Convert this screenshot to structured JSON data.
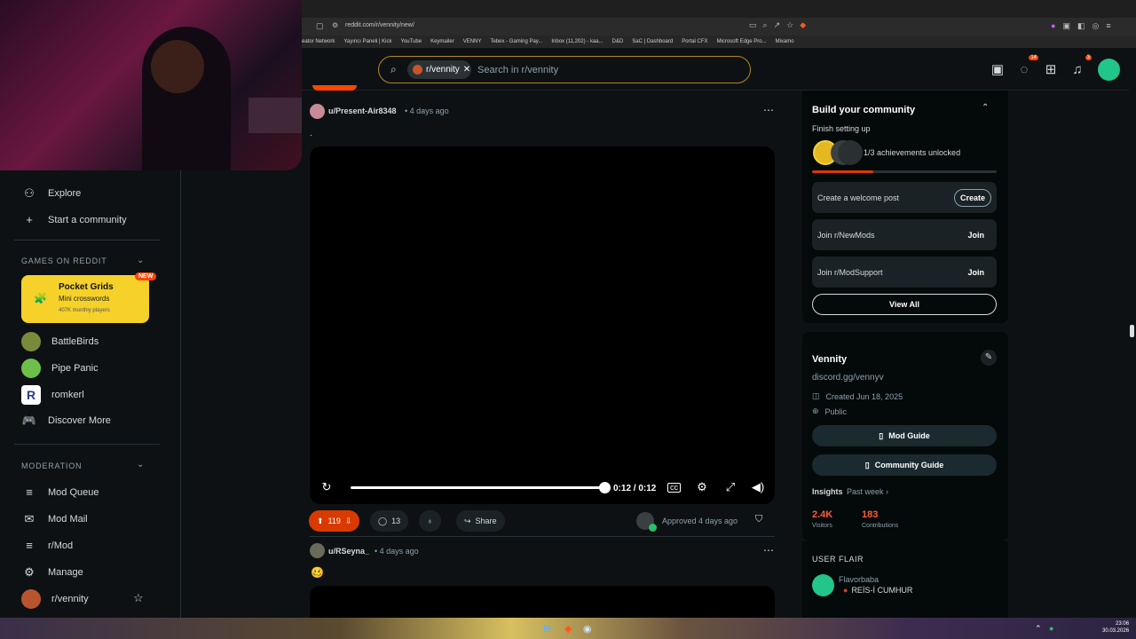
{
  "browser": {
    "url": "reddit.com/r/vennity/new/",
    "bookmarks": [
      "eator Network",
      "Yayıncı Paneli | Kick",
      "YouTube",
      "Keymailer",
      "VENNY",
      "Tebex - Gaming Pay...",
      "Inbox (11,202) - kaa...",
      "D&D",
      "SaC | Dashboard",
      "Portal CFX",
      "Microsoft Edge Pro...",
      "Mixamo"
    ]
  },
  "header": {
    "community_chip": "r/vennity",
    "search_placeholder": "Search in r/vennity",
    "chat_badge": "14",
    "notif_badge": "3"
  },
  "sidebar": {
    "explore": "Explore",
    "start_community": "Start a community",
    "games_title": "GAMES ON REDDIT",
    "pocket_grids": {
      "title": "Pocket Grids",
      "subtitle": "Mini crosswords",
      "players": "407K monthly players",
      "badge": "NEW"
    },
    "games": [
      "BattleBirds",
      "Pipe Panic",
      "romkerl",
      "Discover More"
    ],
    "moderation_title": "MODERATION",
    "mod_items": [
      "Mod Queue",
      "Mod Mail",
      "r/Mod",
      "Manage",
      "r/vennity"
    ]
  },
  "post1": {
    "user": "u/Present-Air8348",
    "time": "4 days ago",
    "body": ".",
    "video_time": "0:12 / 0:12",
    "video_progress": 1.0,
    "upvotes": "119",
    "comments": "13",
    "share": "Share",
    "approved": "Approved 4 days ago"
  },
  "post2": {
    "user": "u/RSeyna_",
    "time": "4 days ago",
    "body": "🥴"
  },
  "right": {
    "build_title": "Build your community",
    "finish_setup": "Finish setting up",
    "achievements": "1/3 achievements unlocked",
    "achievement_progress": 0.33,
    "rows": [
      {
        "label": "Create a welcome post",
        "action": "Create"
      },
      {
        "label": "Join r/NewMods",
        "action": "Join"
      },
      {
        "label": "Join r/ModSupport",
        "action": "Join"
      }
    ],
    "view_all": "View All",
    "community_name": "Vennity",
    "discord": "discord.gg/vennyv",
    "created": "Created Jun 18, 2025",
    "visibility": "Public",
    "mod_guide": "Mod Guide",
    "community_guide": "Community Guide",
    "insights": "Insights",
    "past_week": "Past week",
    "visitors_val": "2.4K",
    "visitors_label": "Visitors",
    "contrib_val": "183",
    "contrib_label": "Contributions",
    "user_flair_title": "USER FLAIR",
    "flair_name": "Flavorbaba",
    "flair_text": "REİS-İ CUMHUR"
  },
  "taskbar": {
    "time": "23:06",
    "date": "30.03.2026"
  },
  "colors": {
    "accent": "#ff4500",
    "bg": "#0e1113",
    "card": "#1a2226",
    "search_border": "#b48a1f"
  }
}
